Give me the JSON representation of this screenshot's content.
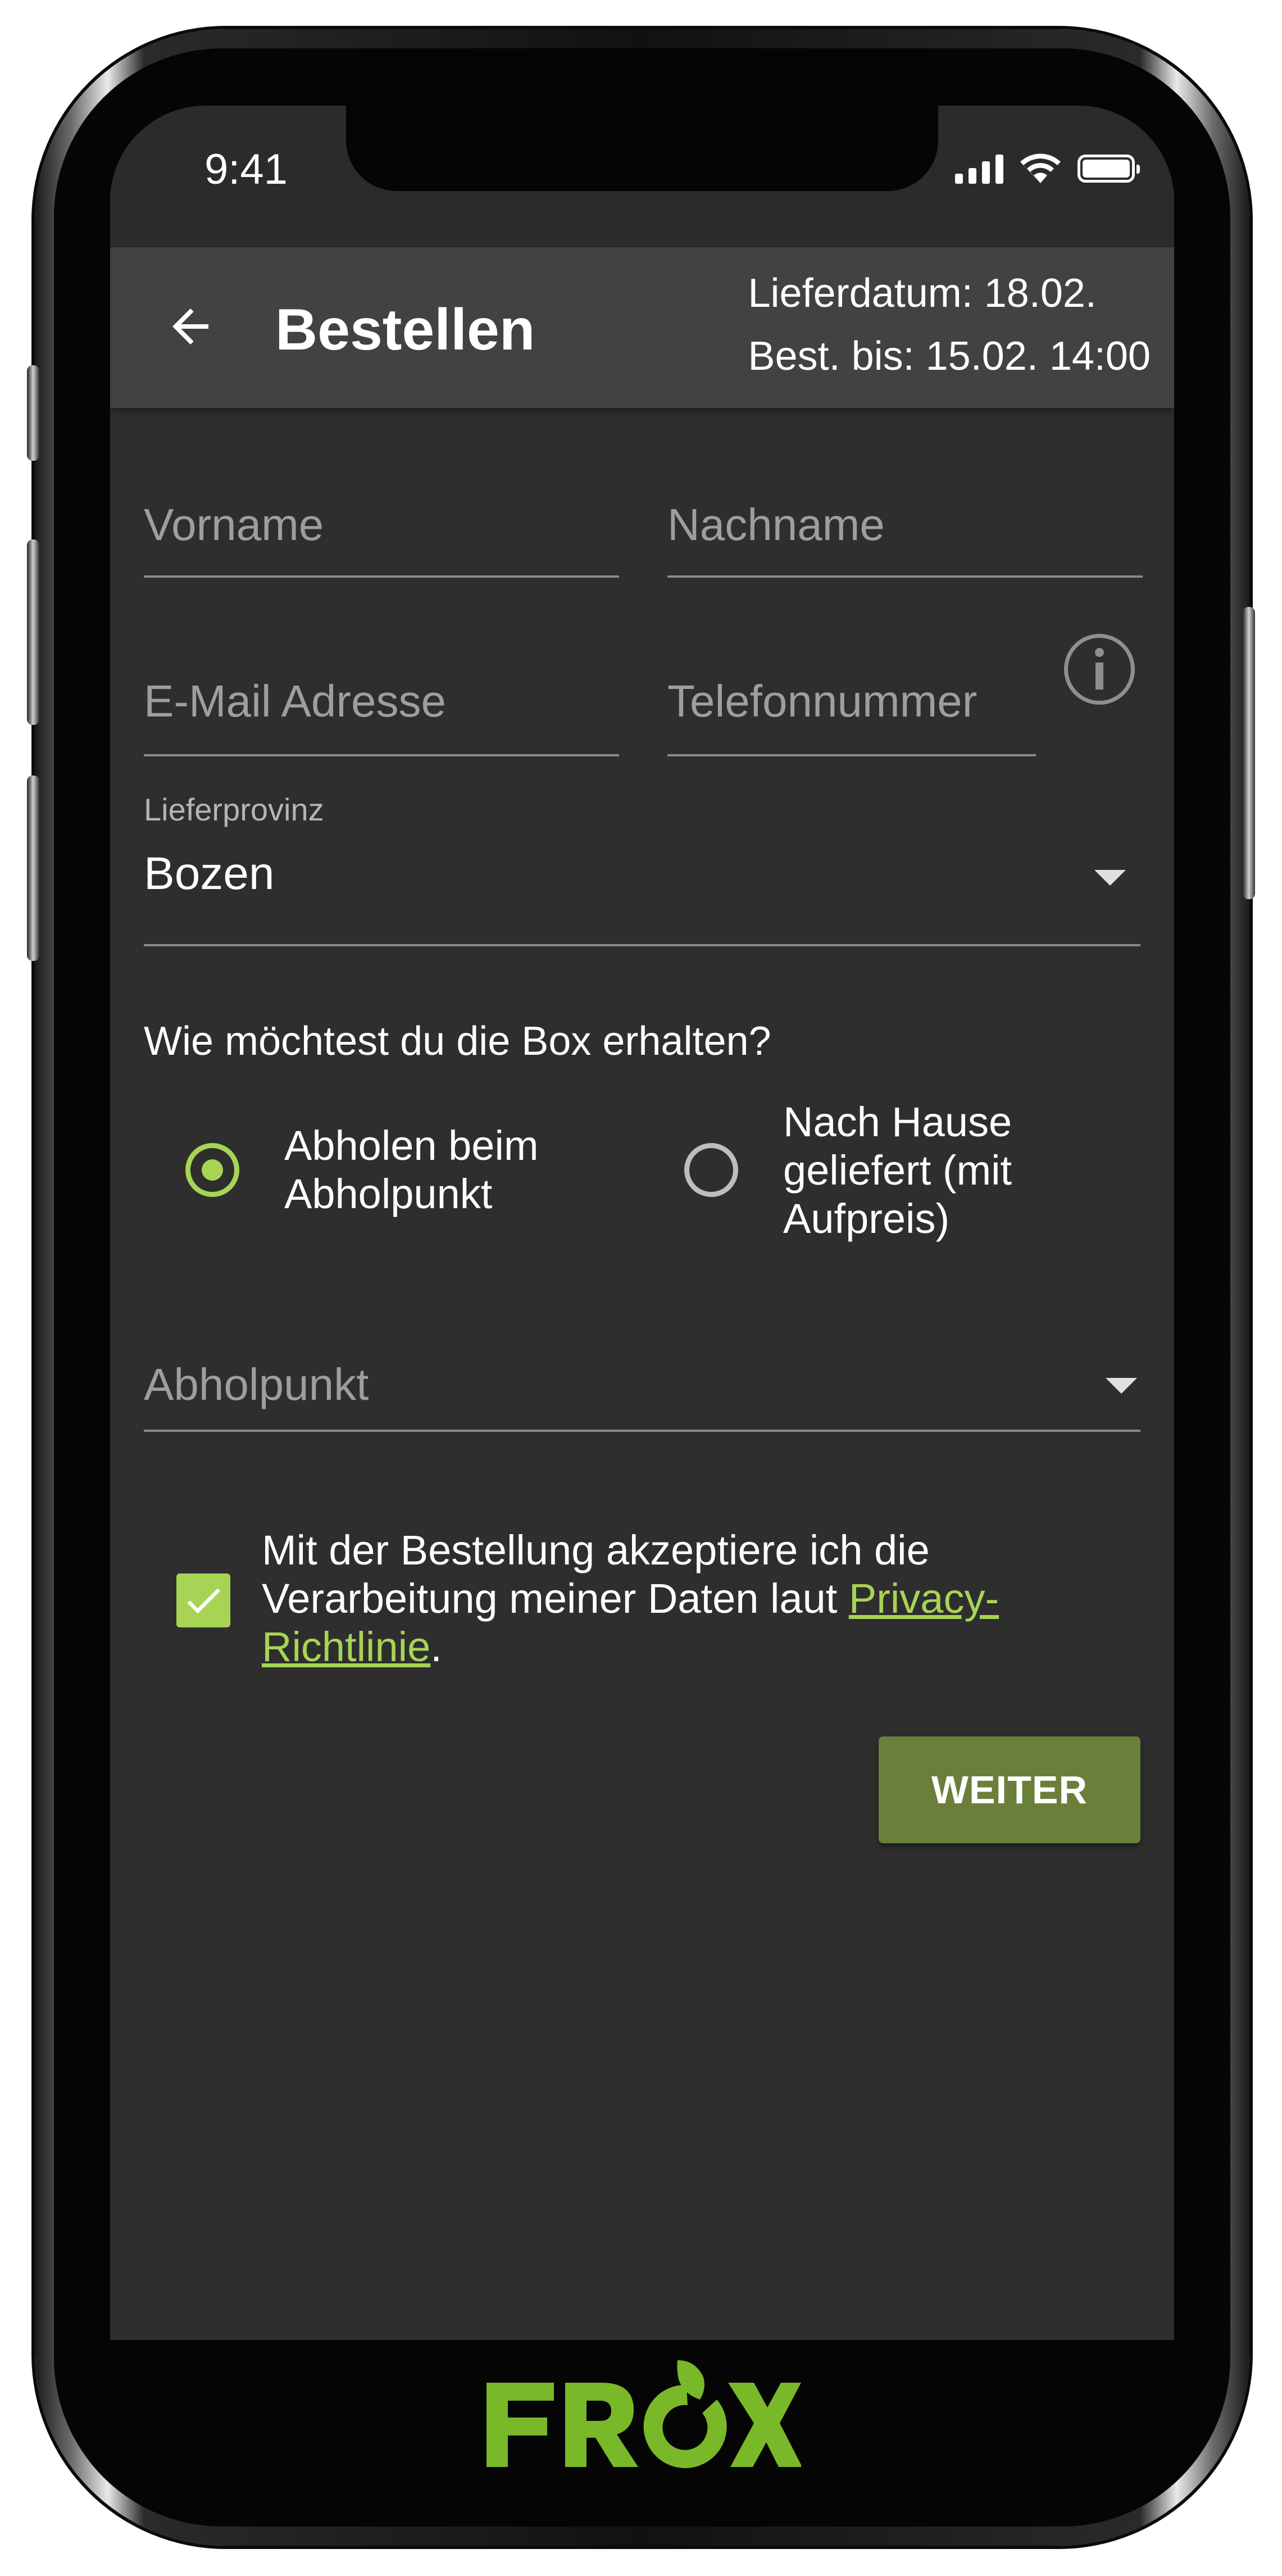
{
  "status_bar": {
    "time": "9:41"
  },
  "app_bar": {
    "title": "Bestellen",
    "delivery_date": "Lieferdatum: 18.02.",
    "order_until": "Best. bis: 15.02. 14:00"
  },
  "form": {
    "first_name_placeholder": "Vorname",
    "last_name_placeholder": "Nachname",
    "email_placeholder": "E-Mail Adresse",
    "phone_placeholder": "Telefonnummer",
    "province": {
      "label": "Lieferprovinz",
      "value": "Bozen"
    },
    "delivery_question": "Wie möchtest du die Box erhalten?",
    "options": [
      {
        "label": "Abholen beim Abholpunkt",
        "selected": true
      },
      {
        "label": "Nach Hause geliefert (mit Aufpreis)",
        "selected": false
      }
    ],
    "pickup_placeholder": "Abholpunkt",
    "consent": {
      "text_before": "Mit der Bestellung akzeptiere ich die Verarbeitung meiner Daten laut",
      "link": "Privacy-Richtlinie",
      "text_after": ".",
      "checked": true
    },
    "submit_label": "WEITER"
  },
  "brand": {
    "logo_text": "FROX"
  },
  "colors": {
    "accent": "#a7d454",
    "button": "#6a7f3a",
    "background": "#2e2e2e",
    "appbar": "#424242"
  }
}
